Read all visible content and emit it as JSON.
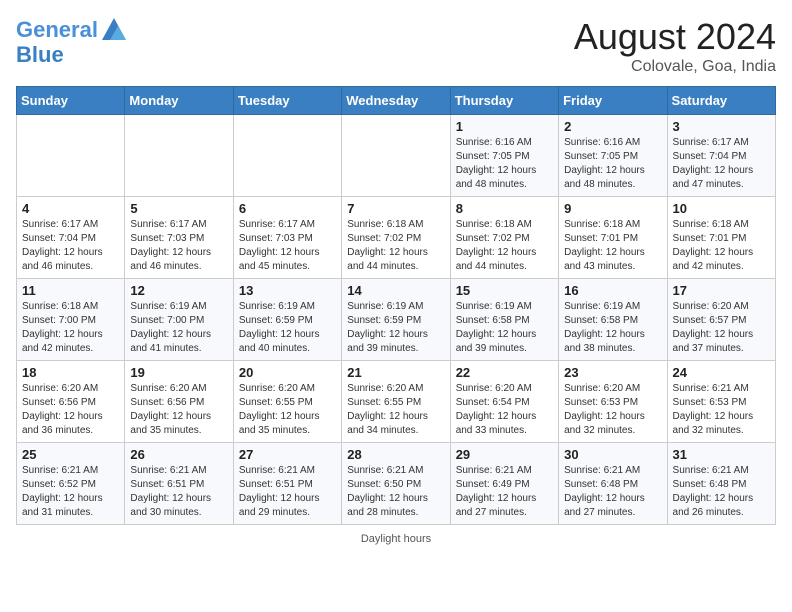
{
  "header": {
    "logo_line1": "General",
    "logo_line2": "Blue",
    "month_year": "August 2024",
    "location": "Colovale, Goa, India"
  },
  "days_of_week": [
    "Sunday",
    "Monday",
    "Tuesday",
    "Wednesday",
    "Thursday",
    "Friday",
    "Saturday"
  ],
  "footer_text": "Daylight hours",
  "weeks": [
    [
      {
        "day": "",
        "info": ""
      },
      {
        "day": "",
        "info": ""
      },
      {
        "day": "",
        "info": ""
      },
      {
        "day": "",
        "info": ""
      },
      {
        "day": "1",
        "info": "Sunrise: 6:16 AM\nSunset: 7:05 PM\nDaylight: 12 hours\nand 48 minutes."
      },
      {
        "day": "2",
        "info": "Sunrise: 6:16 AM\nSunset: 7:05 PM\nDaylight: 12 hours\nand 48 minutes."
      },
      {
        "day": "3",
        "info": "Sunrise: 6:17 AM\nSunset: 7:04 PM\nDaylight: 12 hours\nand 47 minutes."
      }
    ],
    [
      {
        "day": "4",
        "info": "Sunrise: 6:17 AM\nSunset: 7:04 PM\nDaylight: 12 hours\nand 46 minutes."
      },
      {
        "day": "5",
        "info": "Sunrise: 6:17 AM\nSunset: 7:03 PM\nDaylight: 12 hours\nand 46 minutes."
      },
      {
        "day": "6",
        "info": "Sunrise: 6:17 AM\nSunset: 7:03 PM\nDaylight: 12 hours\nand 45 minutes."
      },
      {
        "day": "7",
        "info": "Sunrise: 6:18 AM\nSunset: 7:02 PM\nDaylight: 12 hours\nand 44 minutes."
      },
      {
        "day": "8",
        "info": "Sunrise: 6:18 AM\nSunset: 7:02 PM\nDaylight: 12 hours\nand 44 minutes."
      },
      {
        "day": "9",
        "info": "Sunrise: 6:18 AM\nSunset: 7:01 PM\nDaylight: 12 hours\nand 43 minutes."
      },
      {
        "day": "10",
        "info": "Sunrise: 6:18 AM\nSunset: 7:01 PM\nDaylight: 12 hours\nand 42 minutes."
      }
    ],
    [
      {
        "day": "11",
        "info": "Sunrise: 6:18 AM\nSunset: 7:00 PM\nDaylight: 12 hours\nand 42 minutes."
      },
      {
        "day": "12",
        "info": "Sunrise: 6:19 AM\nSunset: 7:00 PM\nDaylight: 12 hours\nand 41 minutes."
      },
      {
        "day": "13",
        "info": "Sunrise: 6:19 AM\nSunset: 6:59 PM\nDaylight: 12 hours\nand 40 minutes."
      },
      {
        "day": "14",
        "info": "Sunrise: 6:19 AM\nSunset: 6:59 PM\nDaylight: 12 hours\nand 39 minutes."
      },
      {
        "day": "15",
        "info": "Sunrise: 6:19 AM\nSunset: 6:58 PM\nDaylight: 12 hours\nand 39 minutes."
      },
      {
        "day": "16",
        "info": "Sunrise: 6:19 AM\nSunset: 6:58 PM\nDaylight: 12 hours\nand 38 minutes."
      },
      {
        "day": "17",
        "info": "Sunrise: 6:20 AM\nSunset: 6:57 PM\nDaylight: 12 hours\nand 37 minutes."
      }
    ],
    [
      {
        "day": "18",
        "info": "Sunrise: 6:20 AM\nSunset: 6:56 PM\nDaylight: 12 hours\nand 36 minutes."
      },
      {
        "day": "19",
        "info": "Sunrise: 6:20 AM\nSunset: 6:56 PM\nDaylight: 12 hours\nand 35 minutes."
      },
      {
        "day": "20",
        "info": "Sunrise: 6:20 AM\nSunset: 6:55 PM\nDaylight: 12 hours\nand 35 minutes."
      },
      {
        "day": "21",
        "info": "Sunrise: 6:20 AM\nSunset: 6:55 PM\nDaylight: 12 hours\nand 34 minutes."
      },
      {
        "day": "22",
        "info": "Sunrise: 6:20 AM\nSunset: 6:54 PM\nDaylight: 12 hours\nand 33 minutes."
      },
      {
        "day": "23",
        "info": "Sunrise: 6:20 AM\nSunset: 6:53 PM\nDaylight: 12 hours\nand 32 minutes."
      },
      {
        "day": "24",
        "info": "Sunrise: 6:21 AM\nSunset: 6:53 PM\nDaylight: 12 hours\nand 32 minutes."
      }
    ],
    [
      {
        "day": "25",
        "info": "Sunrise: 6:21 AM\nSunset: 6:52 PM\nDaylight: 12 hours\nand 31 minutes."
      },
      {
        "day": "26",
        "info": "Sunrise: 6:21 AM\nSunset: 6:51 PM\nDaylight: 12 hours\nand 30 minutes."
      },
      {
        "day": "27",
        "info": "Sunrise: 6:21 AM\nSunset: 6:51 PM\nDaylight: 12 hours\nand 29 minutes."
      },
      {
        "day": "28",
        "info": "Sunrise: 6:21 AM\nSunset: 6:50 PM\nDaylight: 12 hours\nand 28 minutes."
      },
      {
        "day": "29",
        "info": "Sunrise: 6:21 AM\nSunset: 6:49 PM\nDaylight: 12 hours\nand 27 minutes."
      },
      {
        "day": "30",
        "info": "Sunrise: 6:21 AM\nSunset: 6:48 PM\nDaylight: 12 hours\nand 27 minutes."
      },
      {
        "day": "31",
        "info": "Sunrise: 6:21 AM\nSunset: 6:48 PM\nDaylight: 12 hours\nand 26 minutes."
      }
    ]
  ]
}
